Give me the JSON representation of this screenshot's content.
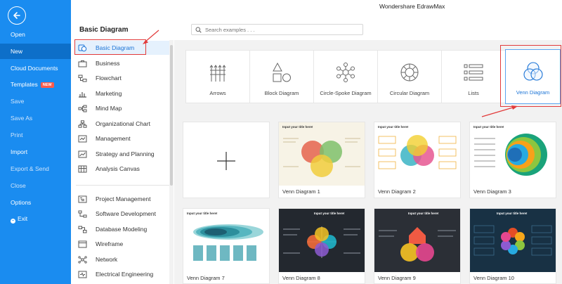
{
  "window_title": "Wondershare EdrawMax",
  "left_nav": {
    "items": [
      {
        "label": "Open",
        "key": "open"
      },
      {
        "label": "New",
        "key": "new",
        "active": true
      },
      {
        "label": "Cloud Documents",
        "key": "cloud-documents"
      },
      {
        "label": "Templates",
        "key": "templates",
        "badge": "NEW"
      },
      {
        "label": "Save",
        "key": "save",
        "dim": true
      },
      {
        "label": "Save As",
        "key": "save-as",
        "dim": true
      },
      {
        "label": "Print",
        "key": "print",
        "dim": true
      },
      {
        "label": "Import",
        "key": "import"
      },
      {
        "label": "Export & Send",
        "key": "export-send",
        "dim": true
      },
      {
        "label": "Close",
        "key": "close",
        "dim": true
      },
      {
        "label": "Options",
        "key": "options"
      },
      {
        "label": "Exit",
        "key": "exit"
      }
    ],
    "colors": {
      "background": "#1a8cf0",
      "active": "#0d6fc9",
      "badge": "#ff5a4a"
    }
  },
  "sidebar": {
    "title": "Basic Diagram",
    "categories": [
      {
        "label": "Basic Diagram",
        "icon": "basic-diagram-icon",
        "selected": true
      },
      {
        "label": "Business",
        "icon": "briefcase-icon"
      },
      {
        "label": "Flowchart",
        "icon": "flowchart-icon"
      },
      {
        "label": "Marketing",
        "icon": "bar-chart-icon"
      },
      {
        "label": "Mind Map",
        "icon": "mind-map-icon"
      },
      {
        "label": "Organizational Chart",
        "icon": "org-chart-icon"
      },
      {
        "label": "Management",
        "icon": "management-icon"
      },
      {
        "label": "Strategy and Planning",
        "icon": "strategy-icon"
      },
      {
        "label": "Analysis Canvas",
        "icon": "analysis-canvas-icon"
      }
    ],
    "categories2": [
      {
        "label": "Project Management",
        "icon": "project-management-icon"
      },
      {
        "label": "Software Development",
        "icon": "software-development-icon"
      },
      {
        "label": "Database Modeling",
        "icon": "database-modeling-icon"
      },
      {
        "label": "Wireframe",
        "icon": "wireframe-icon"
      },
      {
        "label": "Network",
        "icon": "network-icon"
      },
      {
        "label": "Electrical Engineering",
        "icon": "electrical-engineering-icon"
      }
    ]
  },
  "search": {
    "placeholder": "Search examples . . ."
  },
  "diagram_types": [
    {
      "label": "Arrows",
      "icon": "arrows-icon"
    },
    {
      "label": "Block Diagram",
      "icon": "block-diagram-icon"
    },
    {
      "label": "Circle-Spoke Diagram",
      "icon": "circle-spoke-icon"
    },
    {
      "label": "Circular Diagram",
      "icon": "circular-diagram-icon"
    },
    {
      "label": "Lists",
      "icon": "lists-icon"
    },
    {
      "label": "Venn Diagram",
      "icon": "venn-diagram-icon",
      "selected": true
    }
  ],
  "templates": [
    {
      "name": "",
      "kind": "new-blank"
    },
    {
      "name": "Venn Diagram 1",
      "thumb_title": "Input your title here!"
    },
    {
      "name": "Venn Diagram 2",
      "thumb_title": "Input your title here!"
    },
    {
      "name": "Venn Diagram 3",
      "thumb_title": "Input your title here!"
    },
    {
      "name": "Venn Diagram 7",
      "thumb_title": "Input your title here!"
    },
    {
      "name": "Venn Diagram 8",
      "thumb_title": "Input your title here!"
    },
    {
      "name": "Venn Diagram 9",
      "thumb_title": "Input your title here!"
    },
    {
      "name": "Venn Diagram 10",
      "thumb_title": "Input your title here!"
    }
  ],
  "accent_color": "#1a73d6",
  "annotation_color": "#e23a3a"
}
